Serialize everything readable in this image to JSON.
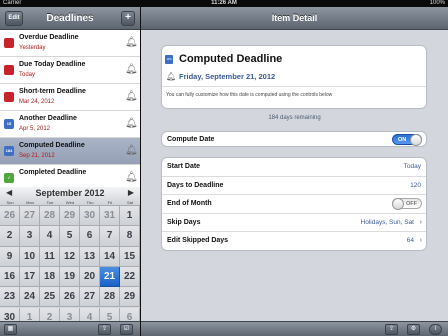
{
  "status": {
    "carrier": "Carrier",
    "time": "11:26 AM",
    "battery": "100%"
  },
  "left": {
    "title": "Deadlines",
    "edit_label": "Edit",
    "add_label": "+",
    "items": [
      {
        "title": "Overdue Deadline",
        "subtitle": "Yesterday",
        "icon_color": "#c8232b",
        "selected": false
      },
      {
        "title": "Due Today Deadline",
        "subtitle": "Today",
        "icon_color": "#c8232b",
        "selected": false
      },
      {
        "title": "Short-term Deadline",
        "subtitle": "Mar 24, 2012",
        "icon_color": "#c8232b",
        "selected": false
      },
      {
        "title": "Another Deadline",
        "subtitle": "Apr 5, 2012",
        "icon_color": "#3f6fc4",
        "icon_text": "15",
        "selected": false
      },
      {
        "title": "Computed Deadline",
        "subtitle": "Sep 21, 2012",
        "icon_color": "#3f6fc4",
        "icon_text": "184",
        "selected": true
      },
      {
        "title": "Completed Deadline",
        "subtitle": "",
        "icon_color": "#4ea83a",
        "icon_text": "✓",
        "selected": false
      }
    ]
  },
  "calendar": {
    "month": "September 2012",
    "weekdays": [
      "Sun",
      "Mon",
      "Tue",
      "Wed",
      "Thu",
      "Fri",
      "Sat"
    ],
    "weeks": [
      [
        "26",
        "27",
        "28",
        "29",
        "30",
        "31",
        "1"
      ],
      [
        "2",
        "3",
        "4",
        "5",
        "6",
        "7",
        "8"
      ],
      [
        "9",
        "10",
        "11",
        "12",
        "13",
        "14",
        "15"
      ],
      [
        "16",
        "17",
        "18",
        "19",
        "20",
        "21",
        "22"
      ],
      [
        "23",
        "24",
        "25",
        "26",
        "27",
        "28",
        "29"
      ],
      [
        "30",
        "1",
        "2",
        "3",
        "4",
        "5",
        "6"
      ]
    ],
    "selected_day": "21"
  },
  "detail": {
    "title": "Item Detail",
    "item_title": "Computed Deadline",
    "item_icon_text": "184",
    "date": "Friday, September 21, 2012",
    "description": "You can fully customize how this date is computed using the controls below",
    "remaining": "184 days remaining",
    "compute_date": {
      "label": "Compute Date",
      "state": "ON"
    },
    "fields": {
      "start_date": {
        "label": "Start Date",
        "value": "Today"
      },
      "days_to_deadline": {
        "label": "Days to Deadline",
        "value": "120"
      },
      "end_of_month": {
        "label": "End of Month",
        "state": "OFF"
      },
      "skip_days": {
        "label": "Skip Days",
        "value": "Holidays, Sun, Sat"
      },
      "edit_skipped_days": {
        "label": "Edit Skipped Days",
        "value": "64"
      }
    }
  },
  "colors": {
    "accent": "#3a5a95",
    "toggle_on": "#2b6fdd",
    "today": "#1b62c8"
  }
}
